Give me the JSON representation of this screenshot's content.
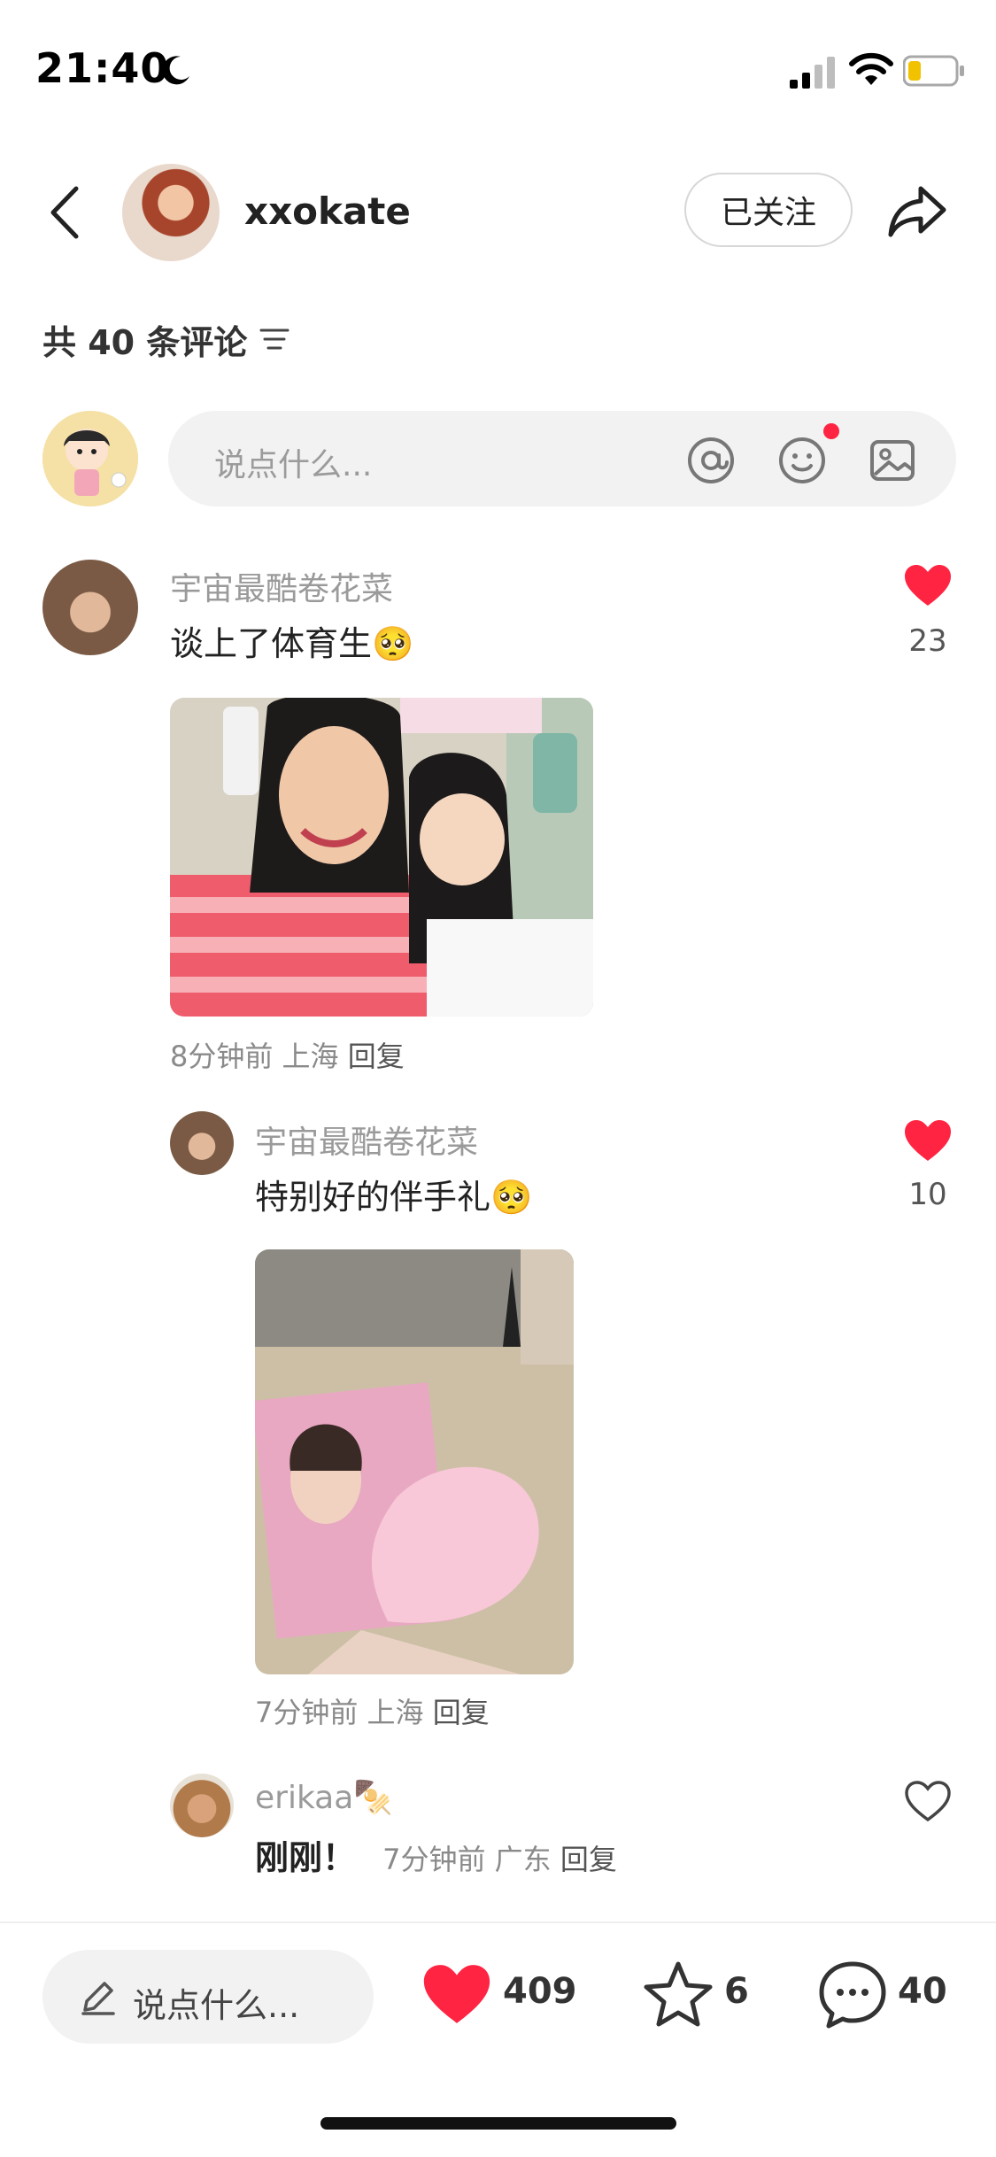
{
  "status_bar": {
    "time": "21:40"
  },
  "header": {
    "username": "xxokate",
    "follow_label": "已关注"
  },
  "comments_header": {
    "count_label": "共 40 条评论"
  },
  "input": {
    "placeholder": "说点什么..."
  },
  "comments": [
    {
      "user": "宇宙最酷卷花菜",
      "text": "谈上了体育生🥺",
      "likes": "23",
      "liked": true,
      "time": "8分钟前",
      "location": "上海",
      "reply_label": "回复",
      "photo_icon": "selfie-photo"
    },
    {
      "user": "宇宙最酷卷花菜",
      "text": "特别好的伴手礼🥺",
      "likes": "10",
      "liked": true,
      "time": "7分钟前",
      "location": "上海",
      "reply_label": "回复",
      "photo_icon": "gift-photo"
    },
    {
      "user": "erikaa🍢",
      "text": "刚刚！",
      "liked": false,
      "time": "7分钟前",
      "location": "广东",
      "reply_label": "回复"
    }
  ],
  "bottom_bar": {
    "input_label": "说点什么...",
    "likes": "409",
    "stars": "6",
    "comments": "40"
  },
  "colors": {
    "accent": "#ff2442",
    "text": "#222222",
    "muted": "#9a9a9a"
  }
}
